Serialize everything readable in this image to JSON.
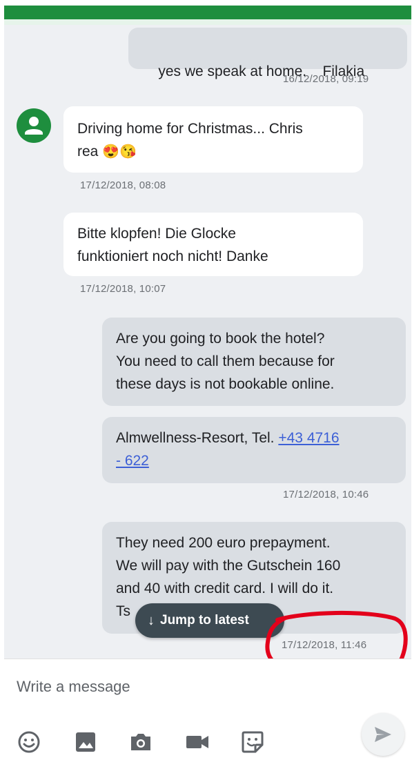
{
  "messages": [
    {
      "text": "yes we speak at home.    Filakia",
      "direction": "outgoing",
      "timestamp": "16/12/2018, 09:19"
    },
    {
      "text": "Driving home for Christmas... Chris",
      "text_line2": "rea",
      "emoji": "😍😘",
      "direction": "incoming",
      "timestamp": "17/12/2018, 08:08"
    },
    {
      "text": "Bitte klopfen! Die Glocke",
      "text_line2": "funktioniert noch nicht! Danke",
      "direction": "incoming",
      "timestamp": "17/12/2018, 10:07"
    },
    {
      "text": "Are you going to book the hotel?",
      "text_line2": "You need to call them because for",
      "text_line3": "these days is not bookable online.",
      "direction": "outgoing"
    },
    {
      "text": "Almwellness-Resort, Tel. ",
      "link_line1": "+43 4716",
      "link_line2": "- 622",
      "direction": "outgoing",
      "timestamp": "17/12/2018, 10:46"
    },
    {
      "text": "They need 200 euro prepayment.",
      "text_line2": "We will pay with the Gutschein 160",
      "text_line3": "and 40 with credit card. I will do it.",
      "text_line4": "Ts",
      "direction": "outgoing",
      "timestamp": "17/12/2018, 11:46"
    }
  ],
  "jump_button": {
    "label": "Jump to latest",
    "icon": "arrow-down-icon"
  },
  "composer": {
    "placeholder": "Write a message",
    "tools": [
      "emoji-icon",
      "image-icon",
      "camera-icon",
      "video-icon",
      "sticker-icon"
    ],
    "send_icon": "send-icon"
  },
  "colors": {
    "accent": "#1e8e3e",
    "annotation": "#e3001b",
    "link": "#3c5fd6"
  }
}
